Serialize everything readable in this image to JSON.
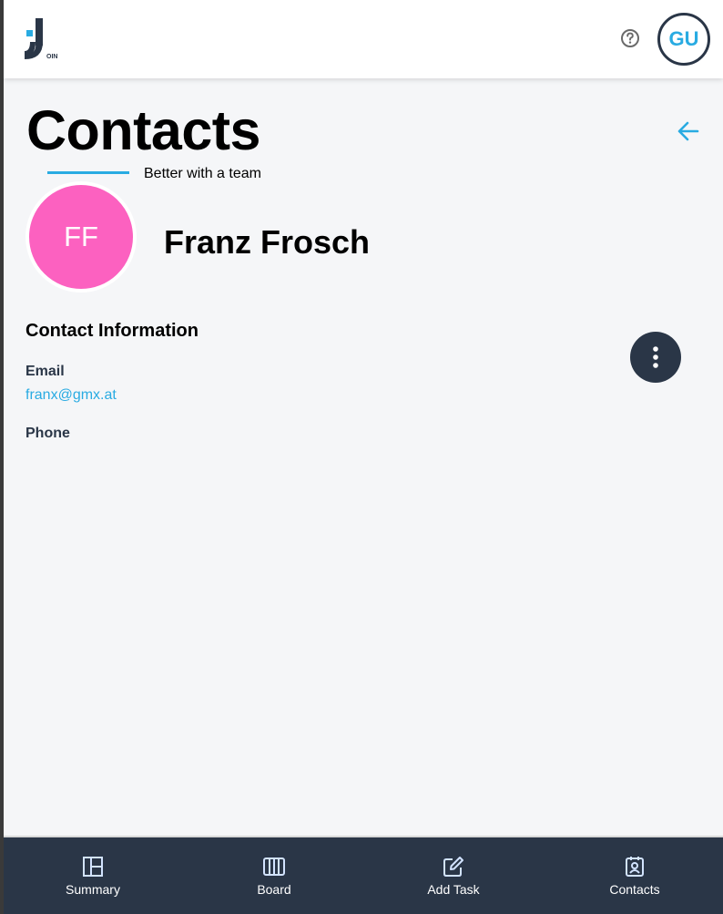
{
  "header": {
    "logo_letter": "J",
    "logo_subtext": "OIN",
    "user_initials": "GU",
    "help_icon": "help-circle-icon"
  },
  "page": {
    "title": "Contacts",
    "subtitle": "Better with a team",
    "back_icon": "arrow-left-icon"
  },
  "contact": {
    "initials": "FF",
    "name": "Franz Frosch",
    "avatar_color": "#fc61c0"
  },
  "info": {
    "section_title": "Contact Information",
    "email_label": "Email",
    "email_value": "franx@gmx.at",
    "phone_label": "Phone",
    "more_icon": "more-vertical-icon"
  },
  "nav": {
    "items": [
      {
        "label": "Summary",
        "icon": "summary-icon"
      },
      {
        "label": "Board",
        "icon": "board-icon"
      },
      {
        "label": "Add Task",
        "icon": "edit-icon"
      },
      {
        "label": "Contacts",
        "icon": "contacts-icon"
      }
    ]
  },
  "colors": {
    "primary": "#2a3647",
    "accent": "#29abe2",
    "background": "#f5f6f8"
  }
}
